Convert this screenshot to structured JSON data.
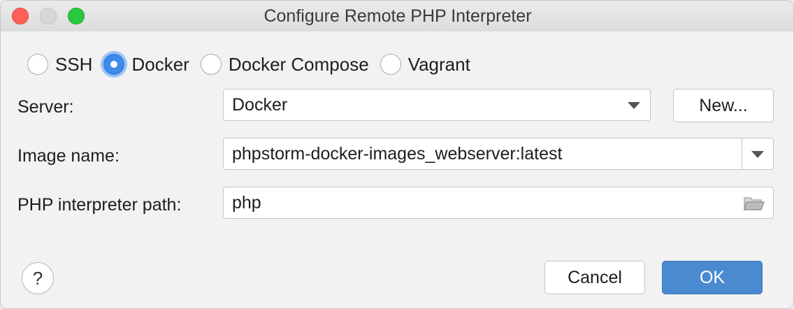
{
  "window": {
    "title": "Configure Remote PHP Interpreter"
  },
  "connection_types": [
    {
      "label": "SSH",
      "selected": false
    },
    {
      "label": "Docker",
      "selected": true
    },
    {
      "label": "Docker Compose",
      "selected": false
    },
    {
      "label": "Vagrant",
      "selected": false
    }
  ],
  "server": {
    "label": "Server:",
    "value": "Docker",
    "new_button": "New..."
  },
  "image": {
    "label": "Image name:",
    "value": "phpstorm-docker-images_webserver:latest"
  },
  "interpreter": {
    "label": "PHP interpreter path:",
    "value": "php"
  },
  "footer": {
    "help": "?",
    "cancel": "Cancel",
    "ok": "OK"
  },
  "colors": {
    "accent": "#4a8ad0",
    "radio_selected": "#3d8ae8",
    "close": "#fe5f57",
    "maximize": "#28c840"
  },
  "icons": {
    "folder": "folder-open-icon",
    "dropdown": "chevron-down-icon",
    "help": "question-mark-icon"
  }
}
